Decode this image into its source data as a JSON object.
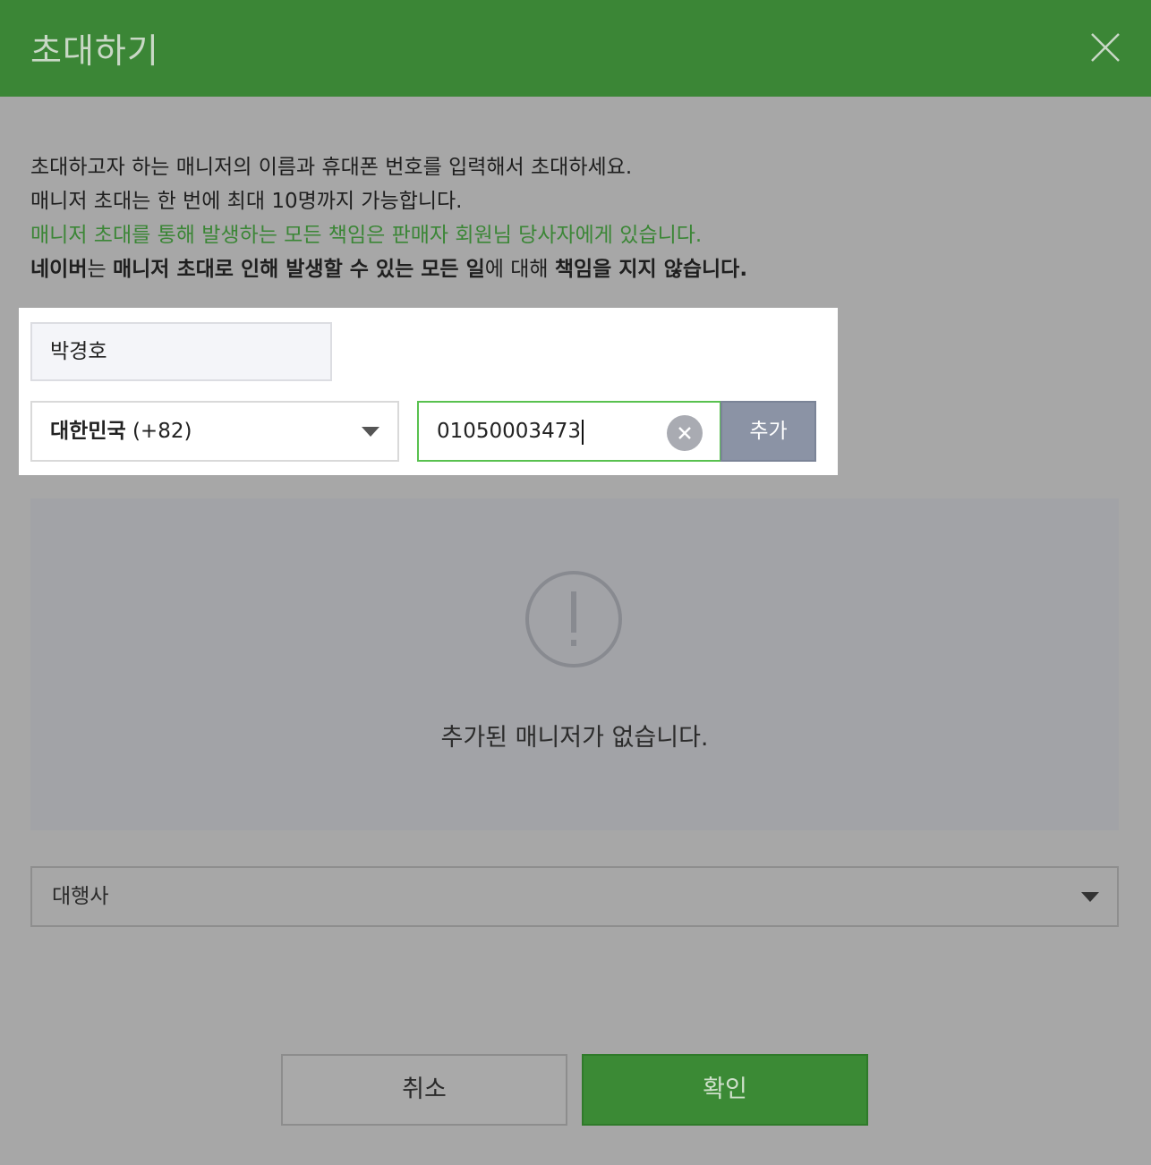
{
  "header": {
    "title": "초대하기"
  },
  "info": {
    "line1": "초대하고자 하는 매니저의 이름과 휴대폰 번호를 입력해서 초대하세요.",
    "line2": "매니저 초대는 한 번에 최대 10명까지 가능합니다.",
    "line3": "매니저 초대를 통해 발생하는 모든 책임은 판매자 회원님 당사자에게 있습니다.",
    "line4": {
      "p1": "네이버",
      "p2": "는 ",
      "p3": "매니저 초대로 인해 발생할 수 있는 모든 일",
      "p4": "에 대해 ",
      "p5": "책임을 지지 않습니다."
    }
  },
  "form": {
    "name_value": "박경호",
    "country_name": "대한민국",
    "country_code": "(+82)",
    "phone_value": "01050003473",
    "add_label": "추가"
  },
  "empty": {
    "message": "추가된 매니저가 없습니다."
  },
  "agency": {
    "selected": "대행사"
  },
  "footer": {
    "cancel_label": "취소",
    "confirm_label": "확인"
  },
  "colors": {
    "header_bg": "#3b8636",
    "accent_green": "#3b8636",
    "add_button": "#8b93a5",
    "phone_focus_border": "#59c14f"
  },
  "icons": {
    "close": "close-icon",
    "clear": "clear-icon",
    "warning": "exclamation-circle-icon",
    "dropdown": "chevron-down-icon"
  }
}
